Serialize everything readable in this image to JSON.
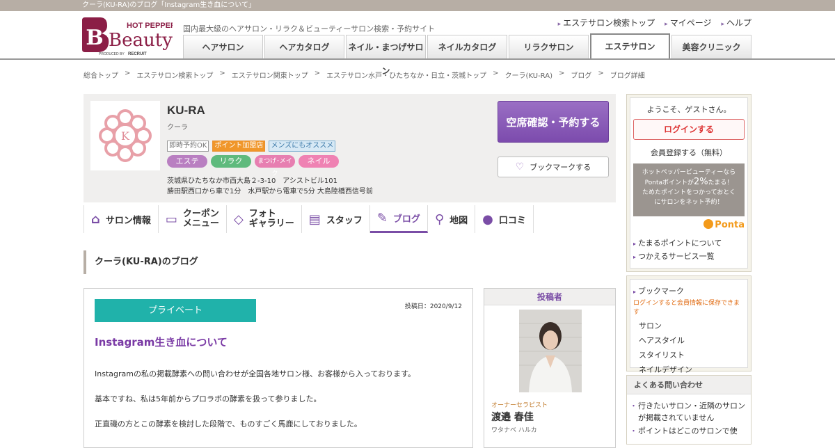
{
  "top_strip": "クーラ(KU-RA)のブログ「Instagram生き血について」",
  "header": {
    "logo_top": "HOT PEPPER",
    "logo_main": "Beauty",
    "logo_sub": "PRODUCED BY",
    "logo_brand": "RECRUIT",
    "tagline": "国内最大級のヘアサロン・リラク＆ビューティーサロン検索・予約サイト",
    "links": [
      "エステサロン検索トップ",
      "マイページ",
      "ヘルプ"
    ],
    "nav": [
      "ヘアサロン",
      "ヘアカタログ",
      "ネイル・まつげサロン",
      "ネイルカタログ",
      "リラクサロン",
      "エステサロン",
      "美容クリニック"
    ],
    "active_nav": "エステサロン"
  },
  "breadcrumb": [
    "総合トップ",
    "エステサロン検索トップ",
    "エステサロン関東トップ",
    "エステサロン水戸・ひたちなか・日立・茨城トップ",
    "クーラ(KU-RA)",
    "ブログ",
    "ブログ詳細"
  ],
  "breadcrumb_sep": ">",
  "salon": {
    "name": "KU-RA",
    "kana": "クーラ",
    "badges": [
      "即時予約OK",
      "ポイント加盟店",
      "メンズにもオススメ"
    ],
    "genres": [
      "エステ",
      "リラク",
      "まつげ･メイク",
      "ネイル"
    ],
    "address": "茨城県ひたちなか市西大島２-3-10　アシストビル101",
    "access": "勝田駅西口から車で1分　水戸駅から電車で5分 大島陸橋西信号前",
    "reserve_label": "空席確認・予約する",
    "bookmark_label": "ブックマークする"
  },
  "salon_nav": {
    "info": "サロン情報",
    "coupon_1": "クーポン",
    "coupon_2": "メニュー",
    "photo_1": "フォト",
    "photo_2": "ギャラリー",
    "staff": "スタッフ",
    "blog": "ブログ",
    "map": "地図",
    "review": "口コミ"
  },
  "blog_heading": "クーラ(KU-RA)のブログ",
  "article": {
    "category": "プライベート",
    "date": "投稿日：2020/9/12",
    "title": "Instagram生き血について",
    "paragraphs": [
      "Instagramの私の掲載酵素への問い合わせが全国各地サロン様、お客様から入っております。",
      "基本ですね、私は5年前からプロラボの酵素を扱って参りました。",
      "正直磯の方とこの酵素を検討した段階で、ものすごく馬鹿にしておりました。"
    ]
  },
  "author": {
    "heading": "投稿者",
    "role": "オーナーセラピスト",
    "name": "渡邉 春佳",
    "kana": "ワタナベ ハルカ"
  },
  "sidebar": {
    "welcome": "ようこそ、ゲストさん。",
    "login": "ログインする",
    "register": "会員登録する（無料）",
    "ponta_line1": "ホットペッパービューティーなら",
    "ponta_line2a": "Pontaポイントが",
    "ponta_big": "2%",
    "ponta_line2b": "たまる！",
    "ponta_line3": "ためたポイントをつかっておとく",
    "ponta_line4": "にサロンをネット予約！",
    "ponta_logo": "Ponta",
    "links": [
      "たまるポイントについて",
      "つかえるサービス一覧"
    ],
    "bookmark_title": "ブックマーク",
    "bookmark_note": "ログインすると会員情報に保存できます",
    "bookmark_items": [
      "サロン",
      "ヘアスタイル",
      "スタイリスト",
      "ネイルデザイン"
    ],
    "faq_title": "よくある問い合わせ",
    "faq_items": [
      "行きたいサロン・近隣のサロンが掲載されていません",
      "ポイントはどこのサロンで使"
    ]
  },
  "colors": {
    "brand_purple": "#7a4da6",
    "category_teal": "#20b2aa",
    "strip": "#b7aea5"
  }
}
